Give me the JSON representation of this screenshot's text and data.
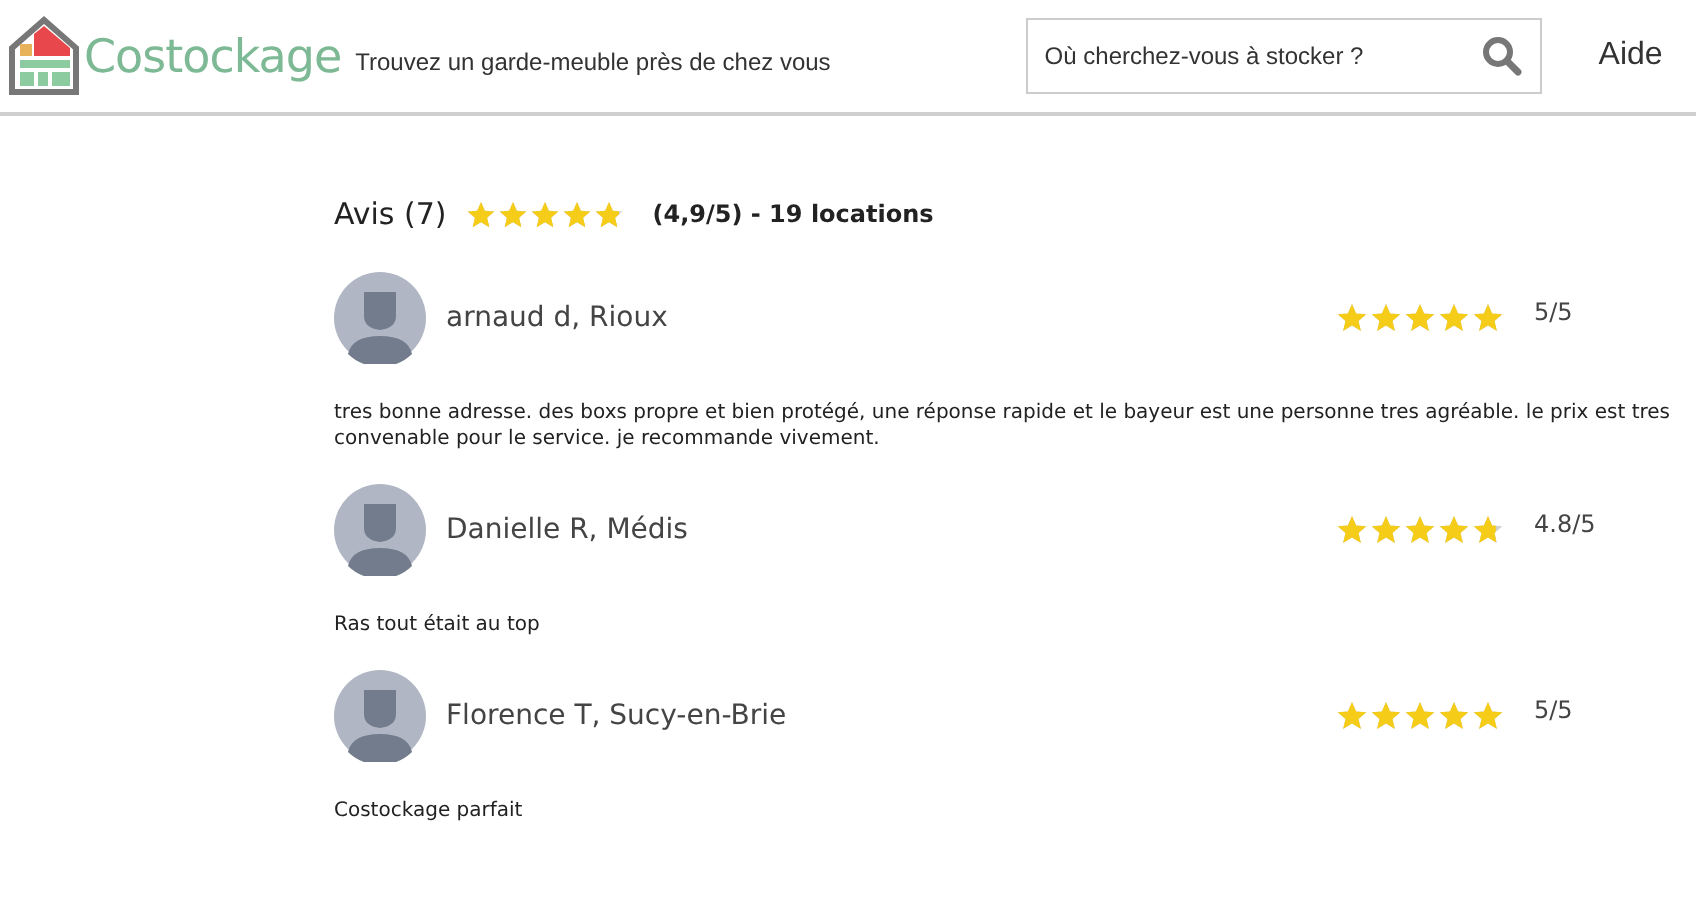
{
  "header": {
    "logo_text": "Costockage",
    "tagline": "Trouvez un garde-meuble près de chez vous",
    "search": {
      "placeholder": "Où cherchez-vous à stocker ?"
    },
    "help_link": "Aide"
  },
  "summary": {
    "title": "Avis (7)",
    "stars": 4.9,
    "rating": "(4,9/5) - 19 locations"
  },
  "reviews": [
    {
      "author": "arnaud d, Rioux",
      "stars": 5,
      "rating": "5/5",
      "text": "tres bonne adresse. des boxs propre et bien protégé, une réponse rapide et le bayeur est une personne tres agréable. le prix est tres convenable pour le service. je recommande vivement."
    },
    {
      "author": "Danielle R, Médis",
      "stars": 4.8,
      "rating": "4.8/5",
      "text": "Ras tout était au top"
    },
    {
      "author": "Florence T, Sucy-en-Brie",
      "stars": 5,
      "rating": "5/5",
      "text": "Costockage parfait"
    }
  ]
}
